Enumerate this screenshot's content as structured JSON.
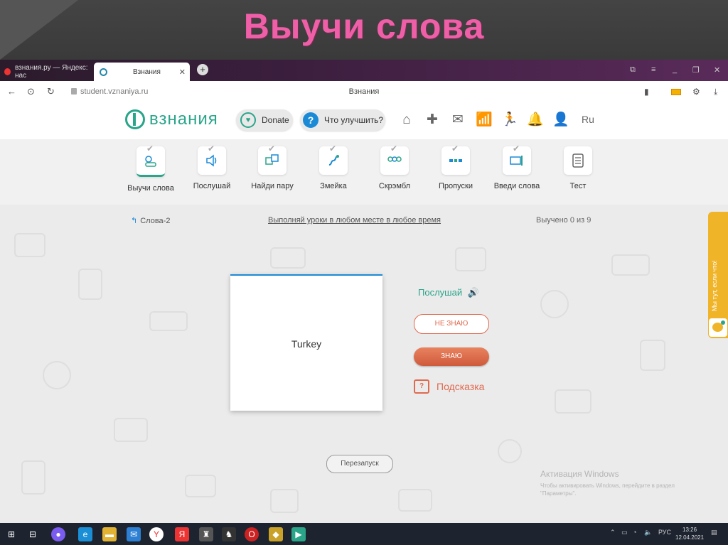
{
  "slide": {
    "title": "Выучи слова"
  },
  "browser": {
    "tabs": [
      {
        "label": "взнания.ру — Яндекс: нас"
      },
      {
        "label": "Взнания"
      }
    ],
    "url": "student.vznaniya.ru",
    "page_title": "Взнания"
  },
  "header": {
    "logo": "взнания",
    "donate": "Donate",
    "improve": "Что улучшить?",
    "lang": "Ru"
  },
  "activities": [
    {
      "label": "Выучи слова"
    },
    {
      "label": "Послушай"
    },
    {
      "label": "Найди пару"
    },
    {
      "label": "Змейка"
    },
    {
      "label": "Скрэмбл"
    },
    {
      "label": "Пропуски"
    },
    {
      "label": "Введи слова"
    },
    {
      "label": "Тест"
    }
  ],
  "main": {
    "back": "Слова-2",
    "promo": "Выполняй уроки в любом месте в любое время",
    "progress": "Выучено 0 из 9",
    "card_word": "Turkey",
    "listen": "Послушай",
    "dont_know": "НЕ ЗНАЮ",
    "know": "ЗНАЮ",
    "hint": "Подсказка",
    "restart": "Перезапуск"
  },
  "sidebar_tab": "Мы тут, если что!",
  "windows_activation": {
    "title": "Активация Windows",
    "subtitle": "Чтобы активировать Windows, перейдите в раздел \"Параметры\"."
  },
  "taskbar": {
    "lang": "РУС",
    "time": "13:26",
    "date": "12.04.2021"
  }
}
